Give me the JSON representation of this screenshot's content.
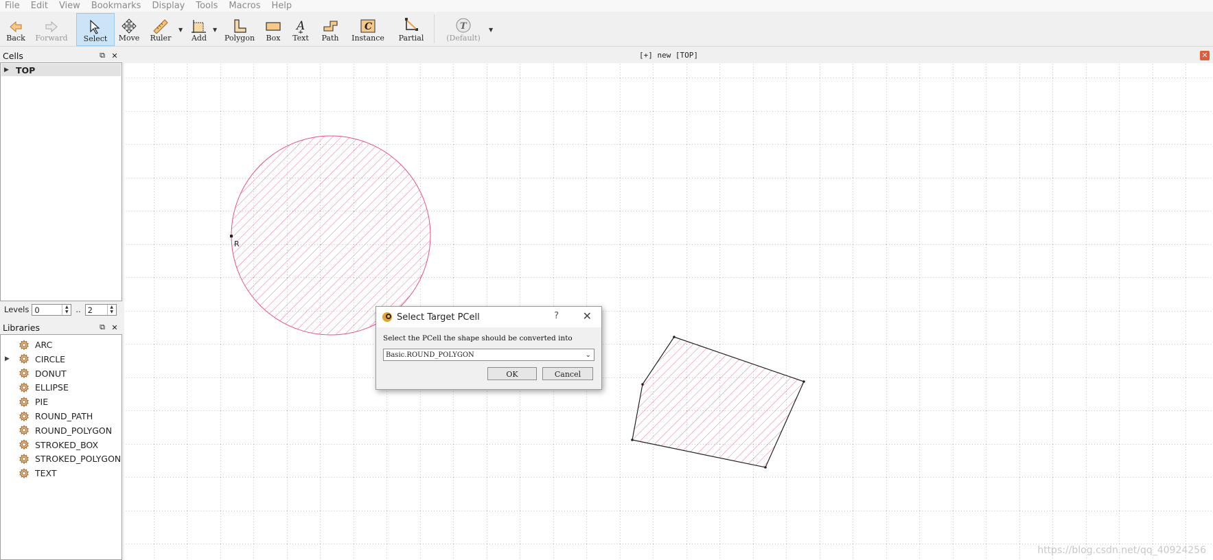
{
  "menu": [
    "File",
    "Edit",
    "View",
    "Bookmarks",
    "Display",
    "Tools",
    "Macros",
    "Help"
  ],
  "toolbar": {
    "back": "Back",
    "forward": "Forward",
    "select": "Select",
    "move": "Move",
    "ruler": "Ruler",
    "add": "Add",
    "polygon": "Polygon",
    "box": "Box",
    "text": "Text",
    "path": "Path",
    "instance": "Instance",
    "partial": "Partial",
    "default": "(Default)"
  },
  "cells_panel": {
    "title": "Cells",
    "top_cell": "TOP"
  },
  "levels": {
    "label": "Levels",
    "from": "0",
    "sep": "..",
    "to": "2"
  },
  "libraries_panel": {
    "title": "Libraries",
    "items": [
      "ARC",
      "CIRCLE",
      "DONUT",
      "ELLIPSE",
      "PIE",
      "ROUND_PATH",
      "ROUND_POLYGON",
      "STROKED_BOX",
      "STROKED_POLYGON",
      "TEXT"
    ]
  },
  "tab": {
    "title": "[+] new [TOP]"
  },
  "canvas": {
    "marker": "R"
  },
  "dialog": {
    "title": "Select Target PCell",
    "help": "?",
    "message": "Select the PCell the shape should be converted into",
    "selected": "Basic.ROUND_POLYGON",
    "ok": "OK",
    "cancel": "Cancel"
  },
  "watermark": "https://blog.csdn.net/qq_40924256",
  "colors": {
    "shape_pink": "#e8507a",
    "selection": "#cce4f7",
    "tab_close": "#e05b3a"
  }
}
